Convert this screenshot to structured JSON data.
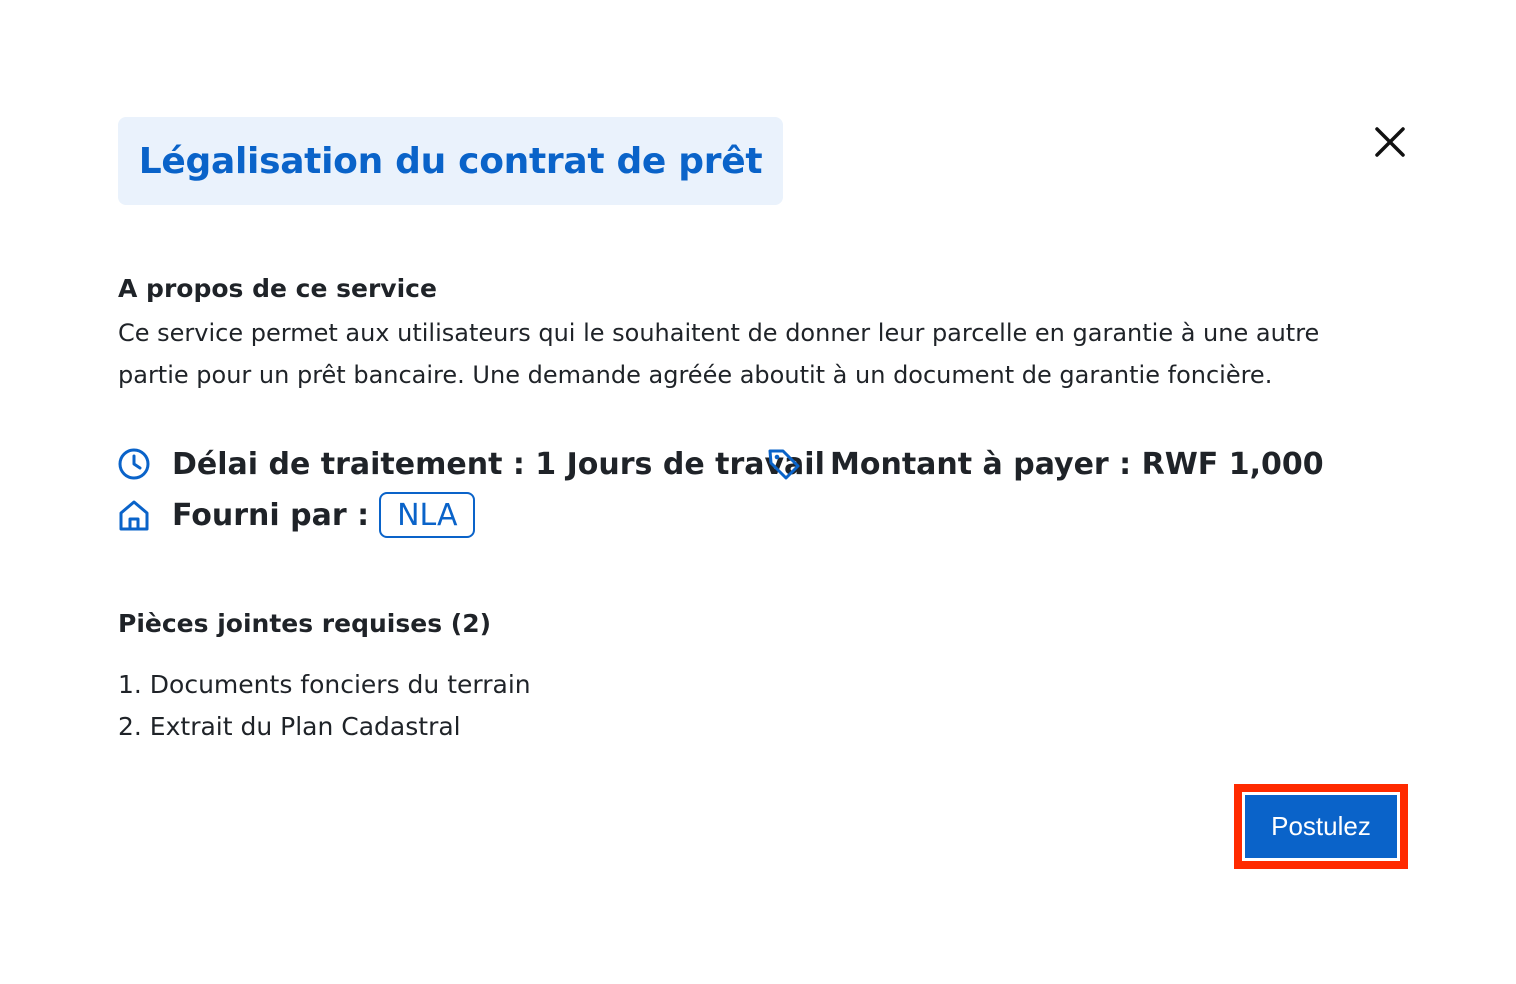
{
  "dialog": {
    "title": "Légalisation du contrat de prêt",
    "close_icon": "close-icon"
  },
  "about": {
    "heading": "A propos de ce service",
    "text": "Ce service permet aux utilisateurs qui le souhaitent de donner leur parcelle en garantie à une autre partie pour un prêt bancaire. Une demande agréée aboutit à un document de garantie foncière."
  },
  "meta": {
    "delay": "Délai de traitement : 1 Jours de travail",
    "delay_icon": "clock-icon",
    "amount": "Montant à payer : RWF 1,000",
    "amount_icon": "price-tag-icon",
    "provider_label": "Fourni par :",
    "provider_value": "NLA",
    "provider_icon": "home-icon"
  },
  "attachments": {
    "heading": "Pièces jointes requises (2)",
    "items": [
      "1. Documents fonciers du terrain",
      "2. Extrait du Plan Cadastral"
    ]
  },
  "actions": {
    "apply_label": "Postulez"
  },
  "colors": {
    "accent": "#0a63c9",
    "title_bg": "#eaf2fc",
    "highlight": "#ff2a00"
  }
}
